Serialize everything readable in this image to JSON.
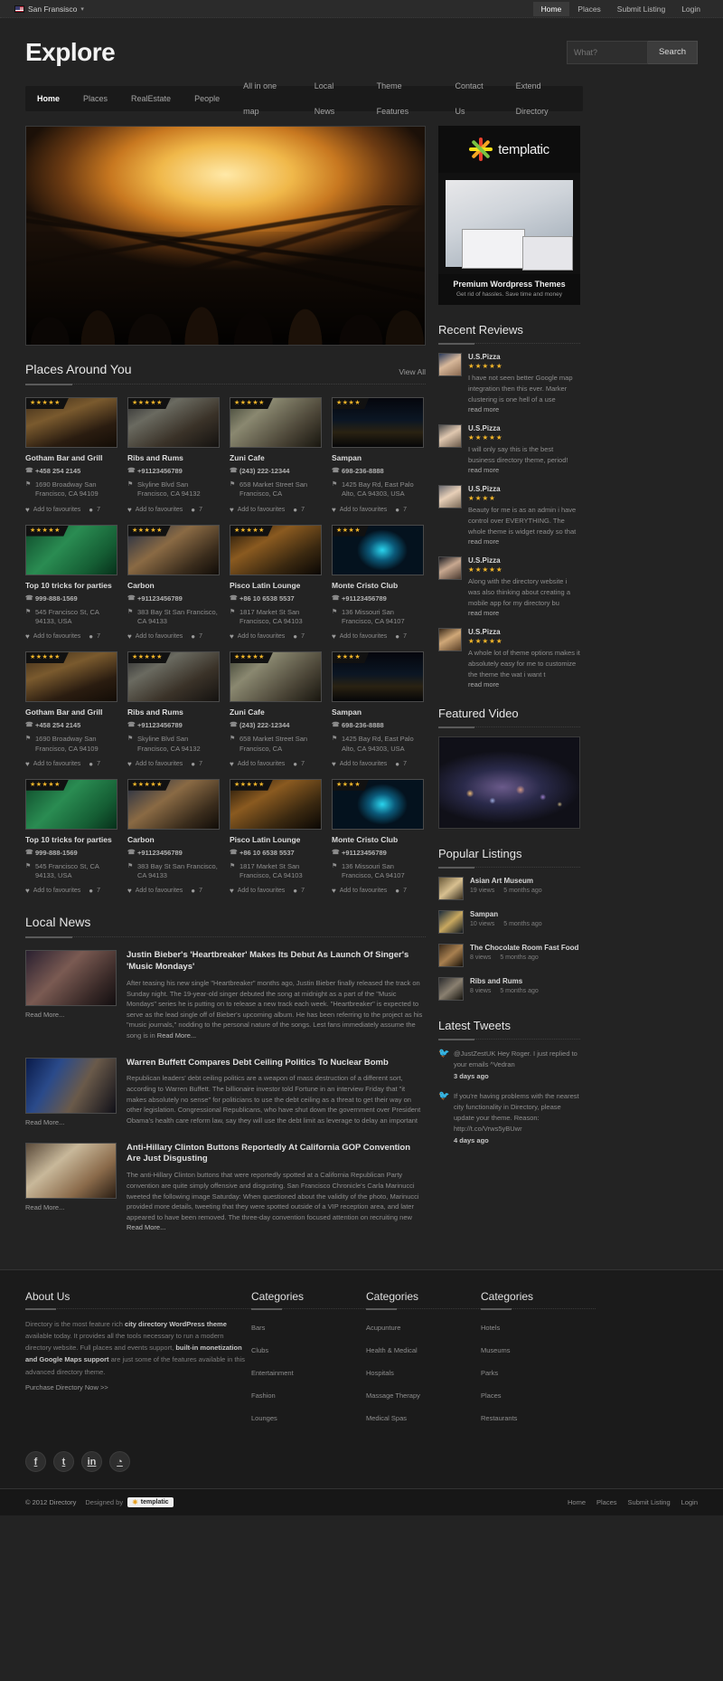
{
  "topbar": {
    "city": "San Fransisco",
    "flag_icon": "us-flag-icon",
    "caret_icon": "chevron-down-icon",
    "nav": [
      {
        "label": "Home",
        "active": true
      },
      {
        "label": "Places",
        "active": false
      },
      {
        "label": "Submit Listing",
        "active": false
      },
      {
        "label": "Login",
        "active": false
      }
    ]
  },
  "header": {
    "logo": "Explore",
    "search": {
      "placeholder": "What?",
      "value": "",
      "button": "Search"
    }
  },
  "mainnav": [
    {
      "label": "Home",
      "active": true
    },
    {
      "label": "Places",
      "active": false
    },
    {
      "label": "RealEstate",
      "active": false
    },
    {
      "label": "People",
      "active": false
    },
    {
      "label": "All in one map",
      "active": false
    },
    {
      "label": "Local News",
      "active": false
    },
    {
      "label": "Theme Features",
      "active": false
    },
    {
      "label": "Contact Us",
      "active": false
    },
    {
      "label": "Extend Directory",
      "active": false
    }
  ],
  "places": {
    "title": "Places Around You",
    "view_all": "View All",
    "fav_label": "Add to favourites",
    "items": [
      {
        "name": "Gotham Bar and Grill",
        "phone": "+458 254 2145",
        "address": "1690 Broadway San Francisco, CA 94109",
        "stars": 5,
        "comments": "7",
        "img": "ph-bar"
      },
      {
        "name": "Ribs and Rums",
        "phone": "+91123456789",
        "address": "Skyline Blvd San Francisco, CA 94132",
        "stars": 5,
        "comments": "7",
        "img": "ph-rest"
      },
      {
        "name": "Zuni Cafe",
        "phone": "(243) 222-12344",
        "address": "658 Market Street San Francisco, CA",
        "stars": 5,
        "comments": "7",
        "img": "ph-cafe"
      },
      {
        "name": "Sampan",
        "phone": "698-236-8888",
        "address": "1425 Bay Rd, East Palo Alto, CA 94303, USA",
        "stars": 4,
        "comments": "7",
        "img": "ph-night"
      },
      {
        "name": "Top 10 tricks for parties",
        "phone": "999-888-1569",
        "address": "545 Francisco St, CA 94133, USA",
        "stars": 5,
        "comments": "7",
        "img": "ph-green"
      },
      {
        "name": "Carbon",
        "phone": "+91123456789",
        "address": "383 Bay St San Francisco, CA 94133",
        "stars": 5,
        "comments": "7",
        "img": "ph-lounge"
      },
      {
        "name": "Pisco Latin Lounge",
        "phone": "+86 10 6538 5537",
        "address": "1817 Market St San Francisco, CA 94103",
        "stars": 5,
        "comments": "7",
        "img": "ph-latin"
      },
      {
        "name": "Monte Cristo Club",
        "phone": "+91123456789",
        "address": "136 Missouri San Francisco, CA 94107",
        "stars": 4,
        "comments": "7",
        "img": "ph-club"
      },
      {
        "name": "Gotham Bar and Grill",
        "phone": "+458 254 2145",
        "address": "1690 Broadway San Francisco, CA 94109",
        "stars": 5,
        "comments": "7",
        "img": "ph-bar"
      },
      {
        "name": "Ribs and Rums",
        "phone": "+91123456789",
        "address": "Skyline Blvd San Francisco, CA 94132",
        "stars": 5,
        "comments": "7",
        "img": "ph-rest"
      },
      {
        "name": "Zuni Cafe",
        "phone": "(243) 222-12344",
        "address": "658 Market Street San Francisco, CA",
        "stars": 5,
        "comments": "7",
        "img": "ph-cafe"
      },
      {
        "name": "Sampan",
        "phone": "698-236-8888",
        "address": "1425 Bay Rd, East Palo Alto, CA 94303, USA",
        "stars": 4,
        "comments": "7",
        "img": "ph-night"
      },
      {
        "name": "Top 10 tricks for parties",
        "phone": "999-888-1569",
        "address": "545 Francisco St, CA 94133, USA",
        "stars": 5,
        "comments": "7",
        "img": "ph-green"
      },
      {
        "name": "Carbon",
        "phone": "+91123456789",
        "address": "383 Bay St San Francisco, CA 94133",
        "stars": 5,
        "comments": "7",
        "img": "ph-lounge"
      },
      {
        "name": "Pisco Latin Lounge",
        "phone": "+86 10 6538 5537",
        "address": "1817 Market St San Francisco, CA 94103",
        "stars": 5,
        "comments": "7",
        "img": "ph-latin"
      },
      {
        "name": "Monte Cristo Club",
        "phone": "+91123456789",
        "address": "136 Missouri San Francisco, CA 94107",
        "stars": 4,
        "comments": "7",
        "img": "ph-club"
      }
    ]
  },
  "local_news": {
    "title": "Local News",
    "read_more": "Read More...",
    "items": [
      {
        "title": "Justin Bieber's 'Heartbreaker' Makes Its Debut As Launch Of Singer's 'Music Mondays'",
        "text": "After teasing his new single \"Heartbreaker\" months ago, Justin Bieber finally released the track on Sunday night. The 19-year-old singer debuted the song at midnight as a part of the \"Music Mondays\" series he is putting on to release a new track each week. \"Heartbreaker\" is expected to serve as the lead single off of Bieber's upcoming album. He has been referring to the project as his \"music journals,\" nodding to the personal nature of the songs. Lest fans immediately assume the song is in",
        "img": "ni-1",
        "more_inline": true
      },
      {
        "title": "Warren Buffett Compares Debt Ceiling Politics To Nuclear Bomb",
        "text": "Republican leaders' debt ceiling politics are a weapon of mass destruction of a different sort, according to Warren Buffett. The billionaire investor told Fortune in an interview Friday that \"it makes absolutely no sense\" for politicians to use the debt ceiling as a threat to get their way on other legislation. Congressional Republicans, who have shut down the government over President Obama's health care reform law, say they will use the debt limit as leverage to delay an important",
        "img": "ni-2",
        "more_inline": false
      },
      {
        "title": "Anti-Hillary Clinton Buttons Reportedly At California GOP Convention Are Just Disgusting",
        "text": "The anti-Hillary Clinton buttons that were reportedly spotted at a California Republican Party convention are quite simply offensive and disgusting. San Francisco Chronicle's Carla Marinucci tweeted the following image Saturday: When questioned about the validity of the photo, Marinucci provided more details, tweeting that they were spotted outside of a VIP reception area, and later appeared to have been removed. The three-day convention focused attention on recruiting new",
        "img": "ni-3",
        "more_inline": true
      }
    ]
  },
  "ad": {
    "brand": "templatic",
    "title": "Premium Wordpress Themes",
    "subtitle": "Get rid of hassles. Save time and money"
  },
  "reviews": {
    "title": "Recent Reviews",
    "read_more": "read more",
    "items": [
      {
        "name": "U.S.Pizza",
        "stars": 5,
        "text": "I have not seen better Google map integration then this ever. Marker clustering is one hell of a use",
        "avatar": "av1"
      },
      {
        "name": "U.S.Pizza",
        "stars": 5,
        "text": "I will only say this is the best business directory theme, period!",
        "avatar": "av2"
      },
      {
        "name": "U.S.Pizza",
        "stars": 4,
        "text": "Beauty for me is as an admin i have control over EVERYTHING. The whole theme is widget ready so that",
        "avatar": "av3"
      },
      {
        "name": "U.S.Pizza",
        "stars": 5,
        "text": "Along with the directory website i was also thinking about creating a mobile app for my directory bu",
        "avatar": "av4"
      },
      {
        "name": "U.S.Pizza",
        "stars": 5,
        "text": "A whole lot of theme options makes it absolutely easy for me to customize the theme the wat i want t",
        "avatar": "av5"
      }
    ]
  },
  "featured_video": {
    "title": "Featured Video"
  },
  "popular": {
    "title": "Popular Listings",
    "items": [
      {
        "name": "Asian Art Museum",
        "views": "19 views",
        "age": "5 months ago",
        "img": "pi1"
      },
      {
        "name": "Sampan",
        "views": "10 views",
        "age": "5 months ago",
        "img": "pi2"
      },
      {
        "name": "The Chocolate Room Fast Food",
        "views": "8 views",
        "age": "5 months ago",
        "img": "pi3"
      },
      {
        "name": "Ribs and Rums",
        "views": "8 views",
        "age": "5 months ago",
        "img": "pi4"
      }
    ]
  },
  "tweets": {
    "title": "Latest Tweets",
    "bird_icon": "twitter-bird-icon",
    "items": [
      {
        "text": "@JustZestUK Hey Roger. I just replied to your emails ^Vedran",
        "time": "3 days ago"
      },
      {
        "text": "If you're having problems with the nearest city functionality in Directory, please update your theme. Reason: http://t.co/Vrws5yBUwr",
        "time": "4 days ago"
      }
    ]
  },
  "footer": {
    "about": {
      "title": "About Us",
      "p1": "Directory is the most feature rich ",
      "b1": "city directory WordPress theme",
      "p2": " available today. It provides all the tools necessary to run a modern directory website. Full places and events support, ",
      "b2": "built-in monetization and Google Maps support",
      "p3": " are just some of the features available in this advanced directory theme.",
      "link": "Purchase Directory Now >>"
    },
    "col2": {
      "title": "Categories",
      "items": [
        "Bars",
        "Clubs",
        "Entertainment",
        "Fashion",
        "Lounges"
      ]
    },
    "col3": {
      "title": "Categories",
      "items": [
        "Acupunture",
        "Health & Medical",
        "Hospitals",
        "Massage Therapy",
        "Medical Spas"
      ]
    },
    "col4": {
      "title": "Categories",
      "items": [
        "Hotels",
        "Museums",
        "Parks",
        "Places",
        "Restaurants"
      ]
    },
    "socials": [
      {
        "name": "facebook-icon",
        "glyph": "f"
      },
      {
        "name": "twitter-icon",
        "glyph": "t"
      },
      {
        "name": "linkedin-icon",
        "glyph": "in"
      },
      {
        "name": "rss-icon",
        "glyph": "◔"
      }
    ],
    "copyright": "© 2012 Directory",
    "designed_by": "Designed by",
    "designer": "templatic",
    "nav": [
      "Home",
      "Places",
      "Submit Listing",
      "Login"
    ]
  },
  "colors": {
    "accent": "#f0b429",
    "bg": "#232323",
    "panel": "#1a1a1a",
    "text": "#cccccc"
  }
}
